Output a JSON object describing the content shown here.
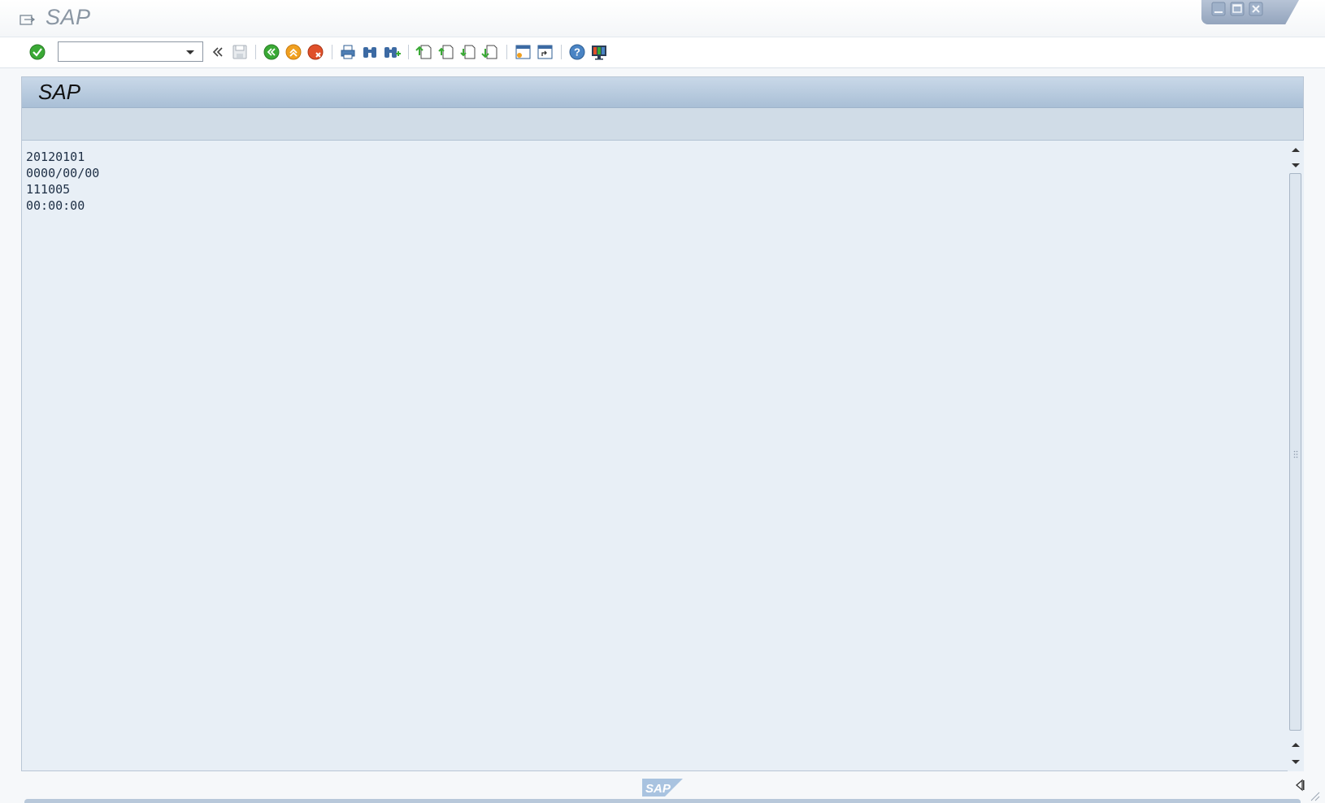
{
  "window": {
    "title": "SAP",
    "controls": [
      "minimize",
      "maximize",
      "close"
    ]
  },
  "toolbar": {
    "command_field_value": "",
    "buttons": [
      "enter",
      "back-nav",
      "save",
      "back",
      "exit",
      "cancel",
      "print",
      "find",
      "find-next",
      "first-page",
      "previous-page",
      "next-page",
      "last-page",
      "create-session",
      "create-shortcut",
      "help",
      "customize-layout"
    ]
  },
  "panel": {
    "title": "SAP",
    "lines": [
      "20120101",
      "0000/00/00",
      "111005",
      "00:00:00"
    ]
  },
  "status": {
    "logo_text": "SAP"
  },
  "colors": {
    "title_gradient_top": "#c9d8e8",
    "title_gradient_bottom": "#a9bfd6",
    "content_bg": "#e8eff6",
    "sub_band": "#d0dce7",
    "text": "#1e2f45",
    "enter_green": "#3aa935",
    "nav_orange": "#f0a020",
    "cancel_red": "#e0502a",
    "help_blue": "#4a84c4"
  }
}
